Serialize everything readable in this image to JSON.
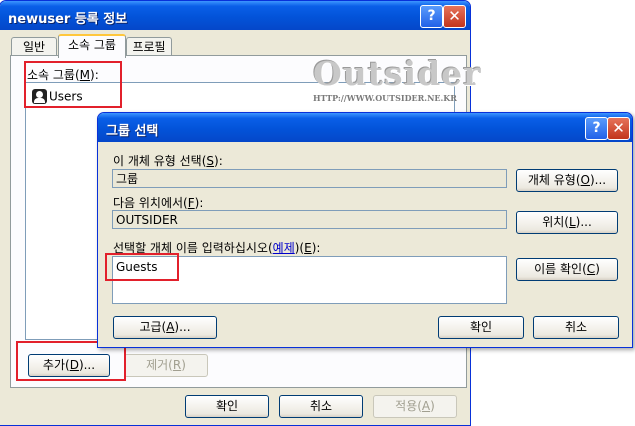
{
  "main_dialog": {
    "title": "newuser 등록 정보",
    "tabs": [
      "일반",
      "소속 그룹",
      "프로필"
    ],
    "group_label_prefix": "소속 그룹(",
    "group_label_key": "M",
    "group_label_suffix": "):",
    "groups": [
      "Users"
    ],
    "add_prefix": "추가(",
    "add_key": "D",
    "add_suffix": ")...",
    "remove_prefix": "제거(",
    "remove_key": "R",
    "remove_suffix": ")",
    "ok_label": "확인",
    "cancel_label": "취소",
    "apply_prefix": "적용(",
    "apply_key": "A",
    "apply_suffix": ")"
  },
  "select_dialog": {
    "title": "그룹 선택",
    "type_label_prefix": "이 개체 유형 선택(",
    "type_label_key": "S",
    "type_label_suffix": "):",
    "type_value": "그룹",
    "type_btn_prefix": "개체 유형(",
    "type_btn_key": "O",
    "type_btn_suffix": ")...",
    "loc_label_prefix": "다음 위치에서(",
    "loc_label_key": "F",
    "loc_label_suffix": "):",
    "loc_value": "OUTSIDER",
    "loc_btn_prefix": "위치(",
    "loc_btn_key": "L",
    "loc_btn_suffix": ")...",
    "name_label_prefix": "선택할 개체 이름 입력하십시오(",
    "name_label_link": "예제",
    "name_label_mid": ")(",
    "name_label_key": "E",
    "name_label_suffix": "):",
    "name_value": "Guests",
    "check_btn_prefix": "이름 확인(",
    "check_btn_key": "C",
    "check_btn_suffix": ")",
    "advanced_prefix": "고급(",
    "advanced_key": "A",
    "advanced_suffix": ")...",
    "ok_label": "확인",
    "cancel_label": "취소"
  },
  "watermark": {
    "logo": "Outsider",
    "url": "HTTP://WWW.OUTSIDER.NE.KR"
  },
  "colors": {
    "titlebar": "#0353d9",
    "highlight": "#e2202b",
    "dialog_bg": "#ece9d8"
  }
}
